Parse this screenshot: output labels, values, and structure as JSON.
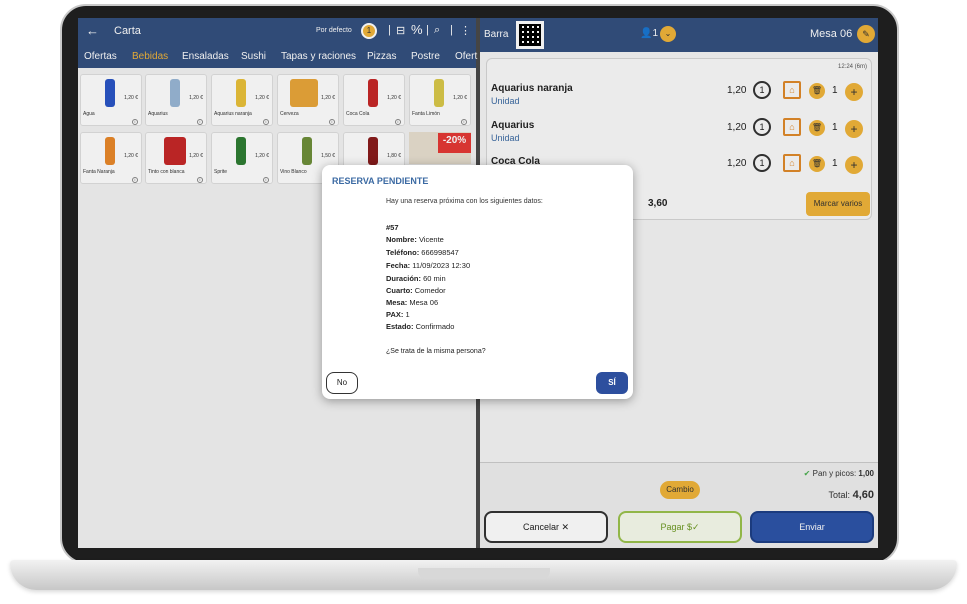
{
  "left": {
    "title": "Carta",
    "sort_label": "Por defecto",
    "badge": "1",
    "categories": [
      "Ofertas",
      "Bebidas",
      "Ensaladas",
      "Sushi",
      "Tapas y raciones",
      "Pizzas",
      "Postre",
      "Ofert"
    ],
    "active_category": "Bebidas",
    "products": [
      {
        "name": "Agua",
        "price": "1,20 €",
        "color": "#2a56c6"
      },
      {
        "name": "Aquarius",
        "price": "1,20 €",
        "color": "#9ab7d6"
      },
      {
        "name": "Aquarius naranja",
        "price": "1,20 €",
        "color": "#e9c13a"
      },
      {
        "name": "Cerveza",
        "price": "1,20 €",
        "color": "#e9a63a"
      },
      {
        "name": "Coca Cola",
        "price": "1,20 €",
        "color": "#c62828"
      },
      {
        "name": "Fanta Limón",
        "price": "1,20 €",
        "color": "#d9c84a"
      },
      {
        "name": "Fanta Naranja",
        "price": "1,20 €",
        "color": "#e9892a"
      },
      {
        "name": "Tinto con blanca",
        "price": "1,20 €",
        "color": "#c62828"
      },
      {
        "name": "Sprite",
        "price": "1,20 €",
        "color": "#2e7d32"
      },
      {
        "name": "Vino Blanco",
        "price": "1,50 €",
        "color": "#6e8f3a"
      },
      {
        "name": "",
        "price": "1,80 €",
        "color": "#8a1c1c"
      }
    ],
    "promo": "-20%"
  },
  "right": {
    "location": "Barra",
    "pax": "1",
    "table": "Mesa 06",
    "time": "12:24 (6m)",
    "items": [
      {
        "name": "Aquarius naranja",
        "unit": "Unidad",
        "price": "1,20",
        "count": "1",
        "qty": "1"
      },
      {
        "name": "Aquarius",
        "unit": "Unidad",
        "price": "1,20",
        "count": "1",
        "qty": "1"
      },
      {
        "name": "Coca Cola",
        "unit": "",
        "price": "1,20",
        "count": "1",
        "qty": "1"
      }
    ],
    "subtotal": "3,60",
    "marcar_label": "Marcar varios",
    "pan_label": "Pan y picos:",
    "pan_value": "1,00",
    "cambio_label": "Cambio",
    "total_label": "Total:",
    "total_value": "4,60",
    "cancel_label": "Cancelar ✕",
    "pay_label": "Pagar $✓",
    "send_label": "Enviar"
  },
  "modal": {
    "title": "RESERVA PENDIENTE",
    "intro": "Hay una reserva próxima con los siguientes datos:",
    "id": "#57",
    "fields": [
      {
        "label": "Nombre:",
        "value": "Vicente"
      },
      {
        "label": "Teléfono:",
        "value": "666998547"
      },
      {
        "label": "Fecha:",
        "value": "11/09/2023 12:30"
      },
      {
        "label": "Duración:",
        "value": "60 min"
      },
      {
        "label": "Cuarto:",
        "value": "Comedor"
      },
      {
        "label": "Mesa:",
        "value": "Mesa 06"
      },
      {
        "label": "PAX:",
        "value": "1"
      },
      {
        "label": "Estado:",
        "value": "Confirmado"
      }
    ],
    "question": "¿Se trata de la misma persona?",
    "no_label": "No",
    "yes_label": "SÍ"
  }
}
